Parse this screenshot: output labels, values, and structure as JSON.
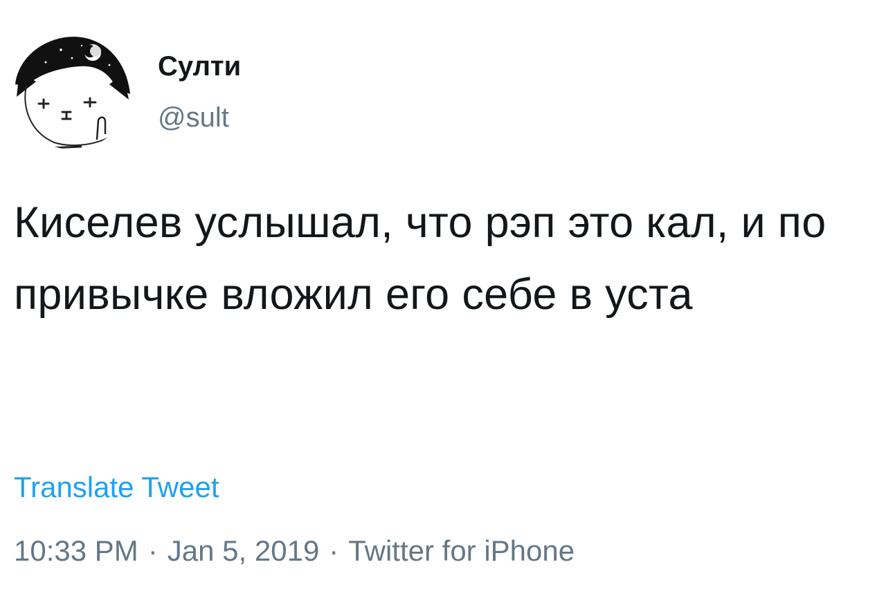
{
  "tweet": {
    "author": {
      "display_name": "Султи",
      "handle": "@sult",
      "avatar_icon": "cat-avatar-icon"
    },
    "text": "Киселев услышал, что рэп это кал, и по привычке вложил его себе в уста",
    "translate_label": "Translate Tweet",
    "time": "10:33 PM",
    "separator": "·",
    "date": "Jan 5, 2019",
    "source": "Twitter for iPhone"
  },
  "colors": {
    "text": "#14171a",
    "secondary": "#657786",
    "link": "#1da1f2"
  }
}
